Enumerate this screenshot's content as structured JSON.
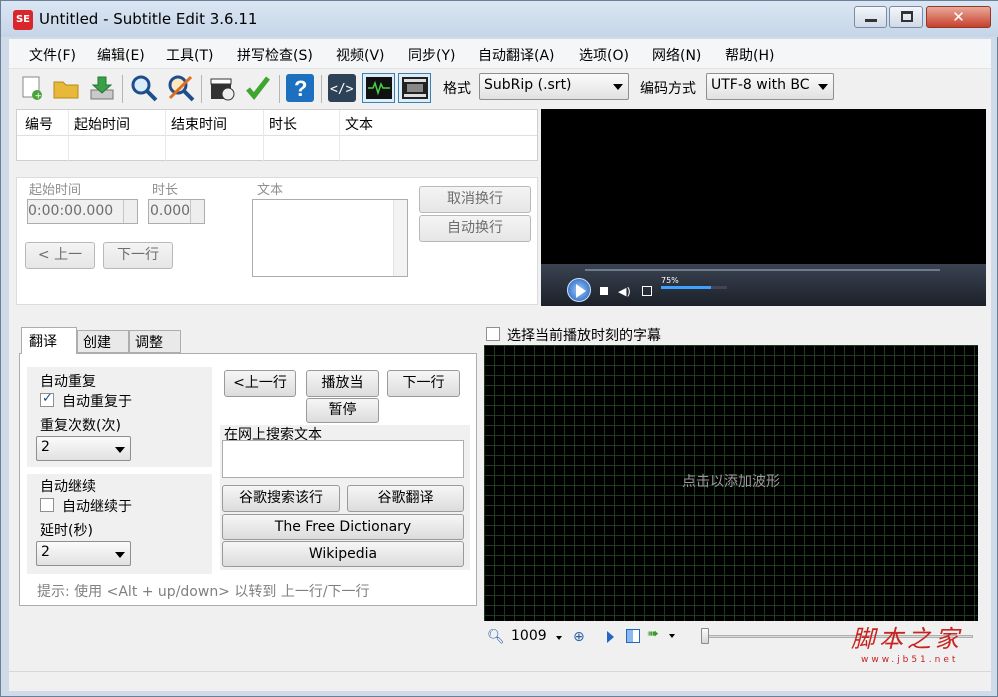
{
  "window": {
    "title": "Untitled - Subtitle Edit 3.6.11",
    "app_icon": "SE"
  },
  "menu": [
    "文件(F)",
    "编辑(E)",
    "工具(T)",
    "拼写检查(S)",
    "视频(V)",
    "同步(Y)",
    "自动翻译(A)",
    "选项(O)",
    "网络(N)",
    "帮助(H)"
  ],
  "toolbar": {
    "format_label": "格式",
    "format_value": "SubRip (.srt)",
    "encoding_label": "编码方式",
    "encoding_value": "UTF-8 with BC"
  },
  "subtitle_table": {
    "columns": [
      "编号",
      "起始时间",
      "结束时间",
      "时长",
      "文本"
    ]
  },
  "editor": {
    "start_label": "起始时间",
    "start_value": "0:00:00.000",
    "duration_label": "时长",
    "duration_value": "0.000",
    "text_label": "文本",
    "undo_wrap": "取消换行",
    "auto_wrap": "自动换行",
    "prev": "< 上一",
    "next": "下一行"
  },
  "video": {
    "volume_label": "75%",
    "volume_level": 0.75
  },
  "tabs": [
    "翻译",
    "创建",
    "调整"
  ],
  "translate": {
    "auto_repeat_title": "自动重复",
    "auto_repeat_check": "自动重复于",
    "auto_repeat_checked": true,
    "repeat_count_label": "重复次数(次)",
    "repeat_count_value": "2",
    "auto_continue_title": "自动继续",
    "auto_continue_check": "自动继续于",
    "auto_continue_checked": false,
    "delay_label": "延时(秒)",
    "delay_value": "2",
    "prev_btn": "<上一行",
    "play_btn": "播放当",
    "next_btn": "下一行",
    "pause_btn": "暂停",
    "search_label": "在网上搜索文本",
    "google_search": "谷歌搜索该行",
    "google_translate": "谷歌翻译",
    "free_dictionary": "The Free Dictionary",
    "wikipedia": "Wikipedia",
    "tip": "提示: 使用 <Alt + up/down> 以转到 上一行/下一行"
  },
  "waveform": {
    "checkbox_label": "选择当前播放时刻的字幕",
    "placeholder": "点击以添加波形",
    "zoom_value": "1009"
  },
  "watermark": {
    "text": "脚本之家",
    "url": "www.jb51.net"
  },
  "colors": {
    "accent": "#3c7fb1",
    "waveform_bg": "#000000",
    "watermark": "#c8231f"
  }
}
